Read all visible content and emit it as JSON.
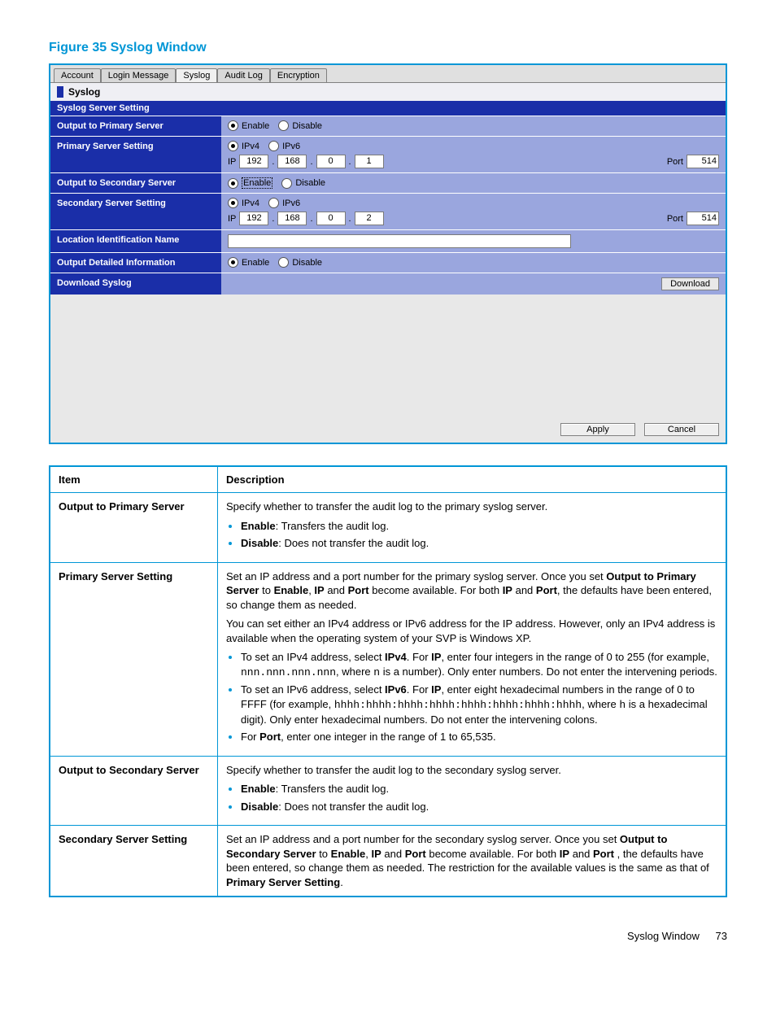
{
  "figureTitle": "Figure 35 Syslog Window",
  "tabs": [
    "Account",
    "Login Message",
    "Syslog",
    "Audit Log",
    "Encryption"
  ],
  "activeTab": "Syslog",
  "sectionHeader": "Syslog",
  "subHeader": "Syslog Server Setting",
  "rows": {
    "outPrimary": {
      "label": "Output to Primary Server",
      "enable": "Enable",
      "disable": "Disable",
      "selected": "Enable"
    },
    "primarySetting": {
      "label": "Primary Server Setting",
      "ipv4": "IPv4",
      "ipv6": "IPv6",
      "ipSel": "IPv4",
      "ipLabel": "IP",
      "ip": [
        "192",
        "168",
        "0",
        "1"
      ],
      "portLabel": "Port",
      "port": "514"
    },
    "outSecondary": {
      "label": "Output to Secondary Server",
      "enable": "Enable",
      "disable": "Disable",
      "selected": "Enable"
    },
    "secondarySetting": {
      "label": "Secondary Server Setting",
      "ipv4": "IPv4",
      "ipv6": "IPv6",
      "ipSel": "IPv4",
      "ipLabel": "IP",
      "ip": [
        "192",
        "168",
        "0",
        "2"
      ],
      "portLabel": "Port",
      "port": "514"
    },
    "location": {
      "label": "Location Identification Name",
      "value": ""
    },
    "detailed": {
      "label": "Output Detailed Information",
      "enable": "Enable",
      "disable": "Disable",
      "selected": "Enable"
    },
    "download": {
      "label": "Download Syslog",
      "btn": "Download"
    }
  },
  "footer": {
    "apply": "Apply",
    "cancel": "Cancel"
  },
  "table": {
    "headItem": "Item",
    "headDesc": "Description",
    "r1": {
      "item": "Output to Primary Server",
      "p1": "Specify whether to transfer the audit log to the primary syslog server.",
      "b1a": "Enable",
      "b1b": ": Transfers the audit log.",
      "b2a": "Disable",
      "b2b": ": Does not transfer the audit log."
    },
    "r2": {
      "item": "Primary Server Setting",
      "p1a": "Set an IP address and a port number for the primary syslog server. Once you set ",
      "p1b": "Output to Primary Server",
      "p1c": " to ",
      "p1d": "Enable",
      "p1e": ", ",
      "p1f": "IP",
      "p1g": " and ",
      "p1h": "Port",
      "p1i": " become available. For both ",
      "p1j": "IP",
      "p1k": " and ",
      "p1l": "Port",
      "p1m": ", the defaults have been entered, so change them as needed.",
      "p2": "You can set either an IPv4 address or IPv6 address for the IP address. However, only an IPv4 address is available when the operating system of your SVP is Windows XP.",
      "b1a": "To set an IPv4 address, select ",
      "b1b": "IPv4",
      "b1c": ". For ",
      "b1d": "IP",
      "b1e": ", enter four integers in the range of 0 to 255 (for example, ",
      "b1f": "nnn.nnn.nnn.nnn",
      "b1g": ", where ",
      "b1h": "n",
      "b1i": " is a number). Only enter numbers. Do not enter the intervening periods.",
      "b2a": "To set an IPv6 address, select ",
      "b2b": "IPv6",
      "b2c": ". For ",
      "b2d": "IP",
      "b2e": ", enter eight hexadecimal numbers in the range of 0 to FFFF (for example, ",
      "b2f": "hhhh:hhhh:hhhh:hhhh:hhhh:hhhh:hhhh:hhhh",
      "b2g": ", where ",
      "b2h": "h",
      "b2i": " is a hexadecimal digit). Only enter hexadecimal numbers. Do not enter the intervening colons.",
      "b3a": "For ",
      "b3b": "Port",
      "b3c": ", enter one integer in the range of 1 to 65,535."
    },
    "r3": {
      "item": "Output to Secondary Server",
      "p1": "Specify whether to transfer the audit log to the secondary syslog server.",
      "b1a": "Enable",
      "b1b": ": Transfers the audit log.",
      "b2a": "Disable",
      "b2b": ": Does not transfer the audit log."
    },
    "r4": {
      "item": "Secondary Server Setting",
      "p1a": "Set an IP address and a port number for the secondary syslog server. Once you set ",
      "p1b": "Output to Secondary Server",
      "p1c": " to ",
      "p1d": "Enable",
      "p1e": ", ",
      "p1f": "IP",
      "p1g": " and ",
      "p1h": "Port",
      "p1i": " become available. For both ",
      "p1j": "IP",
      "p1k": " and ",
      "p1l": "Port",
      "p1m": " , the defaults have been entered, so change them as needed. The restriction for the available values is the same as that of ",
      "p1n": "Primary Server Setting",
      "p1o": "."
    }
  },
  "pageFoot": {
    "text": "Syslog Window",
    "num": "73"
  }
}
